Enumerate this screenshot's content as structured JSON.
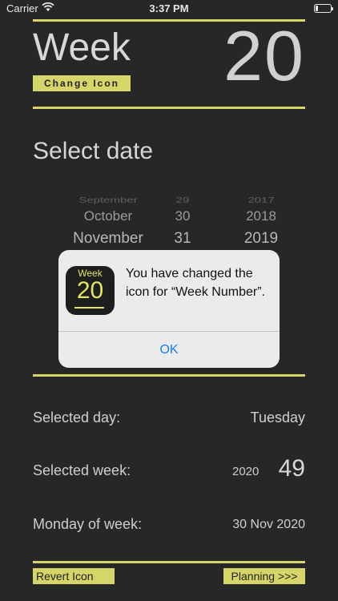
{
  "status": {
    "carrier": "Carrier",
    "time": "3:37 PM"
  },
  "header": {
    "title": "Week",
    "week_number": "20",
    "change_icon_label": "Change Icon"
  },
  "select_date_label": "Select date",
  "picker": {
    "rows": [
      {
        "month": "September",
        "day": "29",
        "year": "2017"
      },
      {
        "month": "October",
        "day": "30",
        "year": "2018"
      },
      {
        "month": "November",
        "day": "31",
        "year": "2019"
      }
    ]
  },
  "alert": {
    "icon_week": "Week",
    "icon_number": "20",
    "message": "You have changed the icon for “Week Number”.",
    "ok_label": "OK"
  },
  "info": {
    "selected_day_label": "Selected day:",
    "selected_day_value": "Tuesday",
    "selected_week_label": "Selected week:",
    "selected_week_year": "2020",
    "selected_week_number": "49",
    "monday_label": "Monday of week:",
    "monday_value": "30 Nov 2020"
  },
  "footer": {
    "revert_label": "Revert Icon",
    "planning_label": "Planning >>>"
  },
  "colors": {
    "accent": "#d5d56a",
    "background": "#272727",
    "link": "#1a7cf0"
  }
}
